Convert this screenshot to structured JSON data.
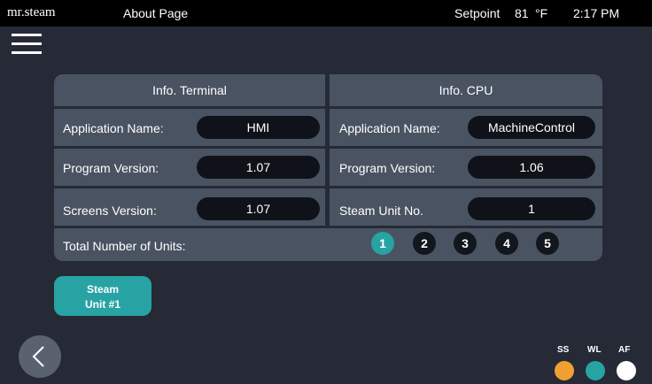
{
  "topbar": {
    "brand": "mr.steam",
    "title": "About Page",
    "setpoint_label": "Setpoint",
    "setpoint_value": "81",
    "setpoint_unit": "°F",
    "time": "2:17 PM"
  },
  "terminal": {
    "header": "Info. Terminal",
    "app_name_label": "Application Name:",
    "app_name_value": "HMI",
    "program_version_label": "Program Version:",
    "program_version_value": "1.07",
    "screens_version_label": "Screens Version:",
    "screens_version_value": "1.07"
  },
  "cpu": {
    "header": "Info. CPU",
    "app_name_label": "Application Name:",
    "app_name_value": "MachineControl",
    "program_version_label": "Program Version:",
    "program_version_value": "1.06",
    "steam_unit_label": "Steam Unit No.",
    "steam_unit_value": "1"
  },
  "units": {
    "label": "Total Number of Units:",
    "items": [
      "1",
      "2",
      "3",
      "4",
      "5"
    ],
    "selected": "1"
  },
  "steam_button": {
    "line1": "Steam",
    "line2": "Unit #1"
  },
  "indicators": [
    {
      "label": "SS",
      "color": "#f0a030"
    },
    {
      "label": "WL",
      "color": "#27a3a4"
    },
    {
      "label": "AF",
      "color": "#ffffff"
    }
  ],
  "colors": {
    "accent": "#27a3a4",
    "background": "#252a36",
    "panel": "#4a5362"
  }
}
